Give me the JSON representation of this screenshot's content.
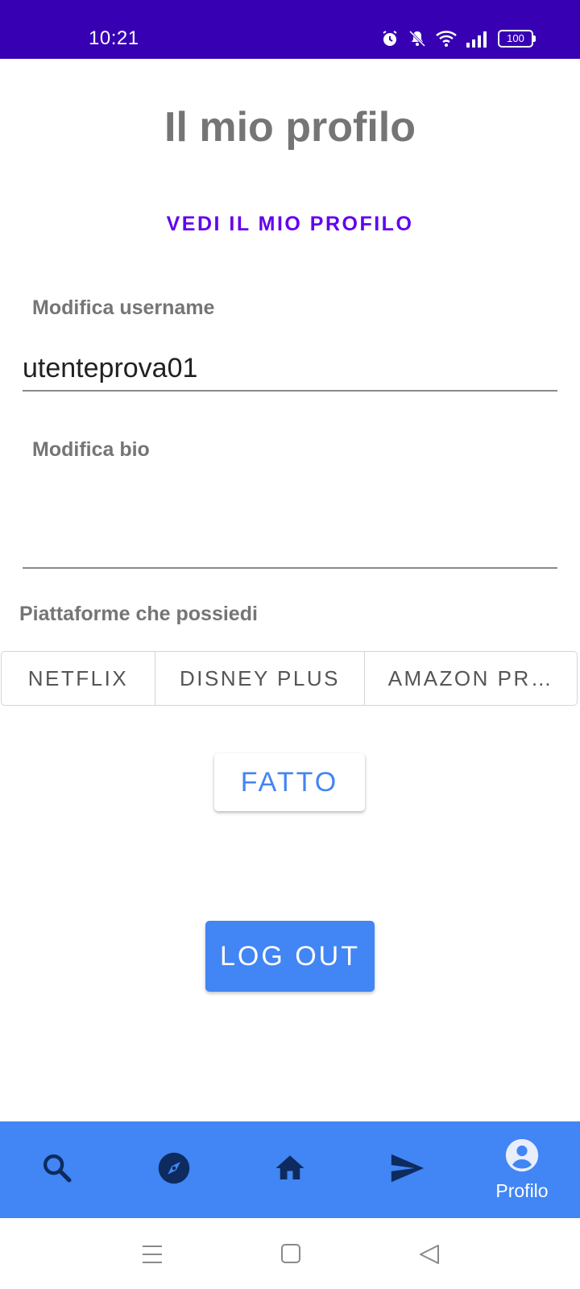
{
  "status_bar": {
    "time": "10:21",
    "battery": "100",
    "bg_color": "#3700b3"
  },
  "page": {
    "title": "Il mio profilo",
    "view_profile": "VEDI IL MIO PROFILO"
  },
  "form": {
    "username_label": "Modifica username",
    "username_value": "utenteprova01",
    "bio_label": "Modifica bio",
    "bio_value": "",
    "platforms_label": "Piattaforme che possiedi",
    "platforms": [
      "NETFLIX",
      "DISNEY PLUS",
      "AMAZON PR…"
    ],
    "done_label": "FATTO"
  },
  "logout_label": "LOG OUT",
  "bottom_nav": {
    "items": [
      {
        "icon": "search-icon"
      },
      {
        "icon": "compass-icon"
      },
      {
        "icon": "home-icon"
      },
      {
        "icon": "send-icon"
      },
      {
        "icon": "account-circle-icon",
        "label": "Profilo"
      }
    ],
    "bg_color": "#4285f4",
    "icon_color": "#0d2b5e"
  },
  "colors": {
    "accent": "#6200ee",
    "primary": "#4285f4",
    "label": "#757575"
  }
}
